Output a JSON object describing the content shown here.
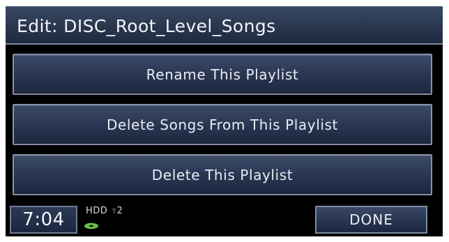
{
  "header": {
    "title": "Edit: DISC_Root_Level_Songs"
  },
  "menu": {
    "items": [
      {
        "label": "Rename This Playlist"
      },
      {
        "label": "Delete Songs From This Playlist"
      },
      {
        "label": "Delete This Playlist"
      }
    ]
  },
  "status": {
    "time": "7:04",
    "source": "HDD",
    "track_marker": "T",
    "track_number": "2",
    "disc_icon": "disc-icon",
    "done_label": "DONE"
  },
  "colors": {
    "background": "#000000",
    "button_top": "#3b4a68",
    "button_bottom": "#1d2740",
    "button_border": "#8792a8",
    "text": "#e9ecf2",
    "disc_icon": "#6cc04a"
  }
}
